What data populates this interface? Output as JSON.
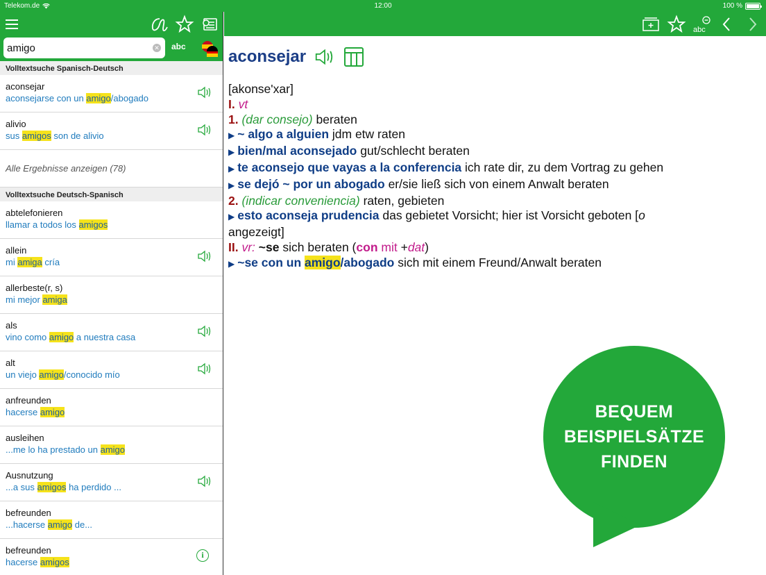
{
  "status_bar": {
    "carrier": "Telekom.de",
    "time": "12:00",
    "battery": "100 %"
  },
  "search": {
    "value": "amigo",
    "abc_label": "abc"
  },
  "sections": [
    {
      "header": "Volltextsuche Spanisch-Deutsch",
      "results": [
        {
          "headword": "aconsejar",
          "pre": "aconsejarse con un ",
          "hl": "amigo",
          "post": "/abogado",
          "icon": "speaker-icon"
        },
        {
          "headword": "alivio",
          "pre": "sus ",
          "hl": "amigos",
          "post": " son de alivio",
          "icon": "speaker-icon"
        }
      ],
      "show_all": "Alle Ergebnisse anzeigen (78)"
    },
    {
      "header": "Volltextsuche Deutsch-Spanisch",
      "results": [
        {
          "headword": "abtelefonieren",
          "pre": "llamar a todos los ",
          "hl": "amigos",
          "post": "",
          "icon": ""
        },
        {
          "headword": "allein",
          "pre": "mi ",
          "hl": "amiga",
          "post": " cría",
          "icon": "speaker-icon"
        },
        {
          "headword": "allerbeste(r, s)",
          "pre": "mi mejor ",
          "hl": "amiga",
          "post": "",
          "icon": ""
        },
        {
          "headword": "als",
          "pre": "vino como ",
          "hl": "amigo",
          "post": " a nuestra casa",
          "icon": "speaker-icon"
        },
        {
          "headword": "alt",
          "pre": "un viejo ",
          "hl": "amigo",
          "post": "/conocido mío",
          "icon": "speaker-icon"
        },
        {
          "headword": "anfreunden",
          "pre": "hacerse ",
          "hl": "amigo",
          "post": "",
          "icon": ""
        },
        {
          "headword": "ausleihen",
          "pre": "...me lo ha prestado un ",
          "hl": "amigo",
          "post": "",
          "icon": ""
        },
        {
          "headword": "Ausnutzung",
          "pre": "...a sus ",
          "hl": "amigos",
          "post": " ha perdido ...",
          "icon": "speaker-icon"
        },
        {
          "headword": "befreunden",
          "pre": "...hacerse ",
          "hl": "amigo",
          "post": " de...",
          "icon": ""
        },
        {
          "headword": "befreunden",
          "pre": "hacerse ",
          "hl": "amigos",
          "post": "",
          "icon": "info-icon"
        }
      ]
    }
  ],
  "entry": {
    "headword": "aconsejar",
    "pronunciation": "[akonse'xar]",
    "l1_num": "I.",
    "l1_pos": "vt",
    "s1_num": "1.",
    "s1_ctx": "(dar consejo)",
    "s1_tr": "beraten",
    "ex1_src": "~ algo a alguien",
    "ex1_tr": "jdm etw raten",
    "ex2_src": "bien/mal aconsejado",
    "ex2_tr": "gut/schlecht beraten",
    "ex3_src": "te aconsejo que vayas a la conferencia",
    "ex3_tr": "ich rate dir, zu dem Vortrag zu gehen",
    "ex4_src": "se dejó ~ por un abogado",
    "ex4_tr": "er/sie ließ sich von einem Anwalt beraten",
    "s2_num": "2.",
    "s2_ctx": "(indicar conveniencia)",
    "s2_tr": "raten, gebieten",
    "ex5_src": "esto aconseja prudencia",
    "ex5_tr": "das gebietet Vorsicht; hier ist Vorsicht geboten [",
    "ex5_o": "o",
    "ex5_tr2": "angezeigt]",
    "l2_num": "II.",
    "l2_pos": "vr:",
    "l2_se": "~se",
    "l2_tr": "sich beraten (",
    "l2_con": "con",
    "l2_mit": "mit",
    "l2_plus": "+",
    "l2_dat": "dat",
    "l2_close": ")",
    "ex6_pre": "~se con un ",
    "ex6_hl": "amigo",
    "ex6_post": "/abogado",
    "ex6_tr": "sich mit einem Freund/Anwalt beraten"
  },
  "promo": {
    "line1": "BEQUEM",
    "line2": "BEISPIELSÄTZE",
    "line3": "FINDEN"
  },
  "colors": {
    "brand_green": "#23a83a",
    "highlight": "#f5e21b",
    "entry_blue": "#0f3d86",
    "link_blue": "#1f7bbd"
  }
}
